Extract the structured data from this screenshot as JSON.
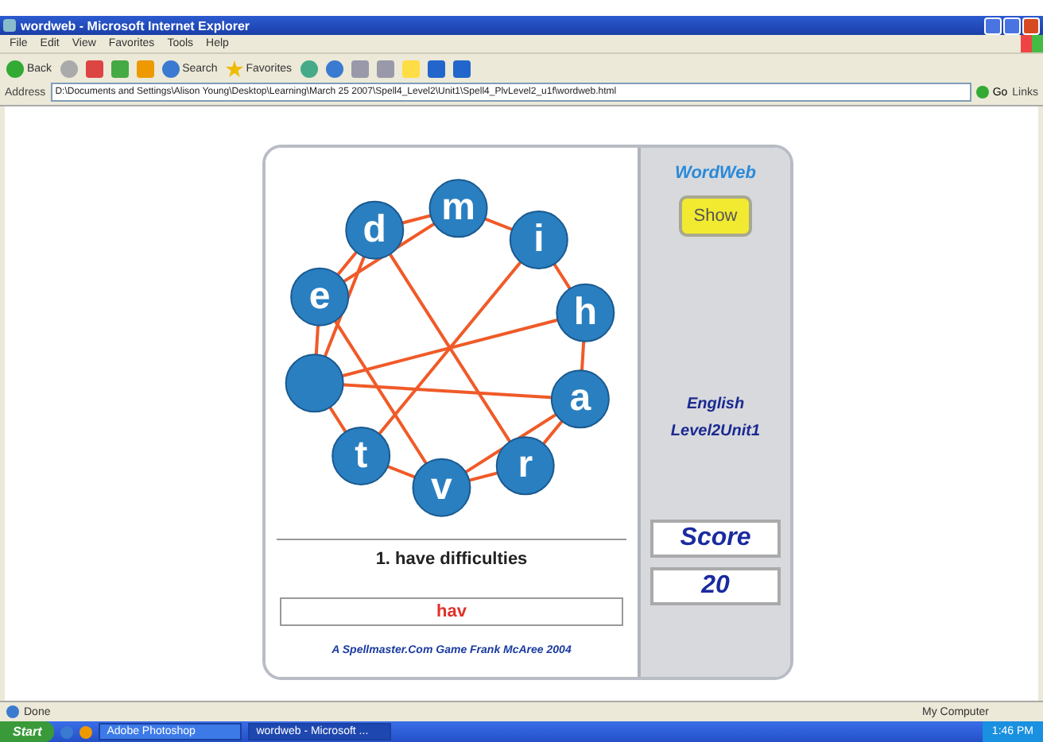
{
  "window": {
    "title": "wordweb - Microsoft Internet Explorer"
  },
  "menu": [
    "File",
    "Edit",
    "View",
    "Favorites",
    "Tools",
    "Help"
  ],
  "toolbar": {
    "back": "Back",
    "search": "Search",
    "favorites": "Favorites"
  },
  "address_bar": {
    "label": "Address",
    "value": "D:\\Documents and Settings\\Alison Young\\Desktop\\Learning\\March 25 2007\\Spell4_Level2\\Unit1\\Spell4_PlvLevel2_u1f\\wordweb.html",
    "go": "Go",
    "links": "Links"
  },
  "game": {
    "title": "WordWeb",
    "show_button": "Show",
    "language": "English",
    "unit": "Level2Unit1",
    "score_label": "Score",
    "score": "20",
    "clue": "1. have difficulties",
    "answer": "hav",
    "credit": "A Spellmaster.Com Game Frank McAree 2004",
    "nodes": [
      {
        "kind": "letter",
        "letter": "m"
      },
      {
        "kind": "letter",
        "letter": "i"
      },
      {
        "kind": "letter",
        "letter": "h"
      },
      {
        "kind": "letter",
        "letter": "a"
      },
      {
        "kind": "letter",
        "letter": "r"
      },
      {
        "kind": "letter",
        "letter": "v"
      },
      {
        "kind": "letter",
        "letter": "t"
      },
      {
        "kind": "blank"
      },
      {
        "kind": "letter",
        "letter": "e"
      },
      {
        "kind": "letter",
        "letter": "d"
      }
    ]
  },
  "status_bar": {
    "status": "Done",
    "zone": "My Computer"
  },
  "taskbar": {
    "start": "Start",
    "tasks": [
      {
        "label": "Adobe Photoshop",
        "selected": false
      },
      {
        "label": "wordweb - Microsoft ...",
        "selected": true
      }
    ],
    "clock": "1:46 PM"
  }
}
